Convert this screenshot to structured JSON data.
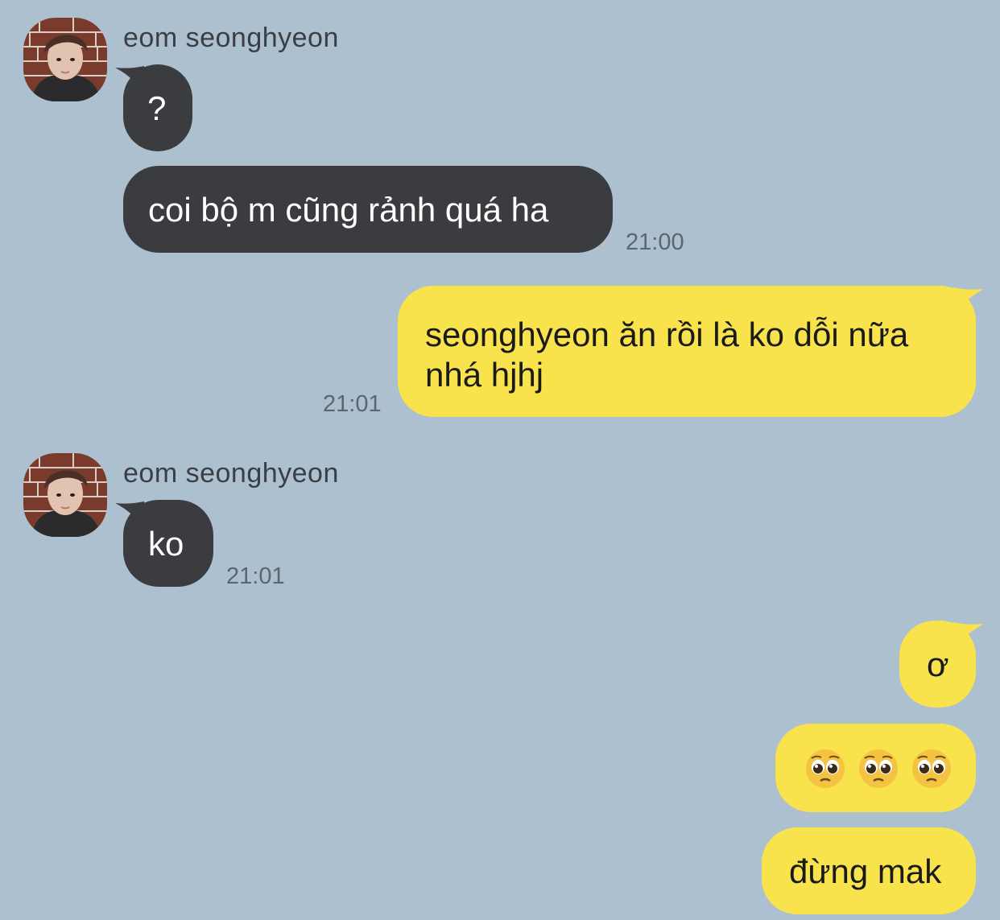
{
  "messages": [
    {
      "sender": "eom seonghyeon",
      "text": "?",
      "side": "left"
    },
    {
      "text": "coi bộ m cũng rảnh quá ha",
      "side": "left",
      "time": "21:00"
    },
    {
      "text": "seonghyeon ăn rồi là ko dỗi nữa nhá hjhj",
      "side": "right",
      "time": "21:01"
    },
    {
      "sender": "eom seonghyeon",
      "text": "ko",
      "side": "left",
      "time": "21:01"
    },
    {
      "text": "ơ",
      "side": "right"
    },
    {
      "text": "🥺🥺🥺",
      "side": "right",
      "icons": [
        "pleading-face-icon",
        "pleading-face-icon",
        "pleading-face-icon"
      ]
    },
    {
      "text": "đừng mak",
      "side": "right"
    }
  ],
  "colors": {
    "background": "#adc0d0",
    "incoming_bubble": "#3b3c40",
    "outgoing_bubble": "#f8e34c"
  }
}
